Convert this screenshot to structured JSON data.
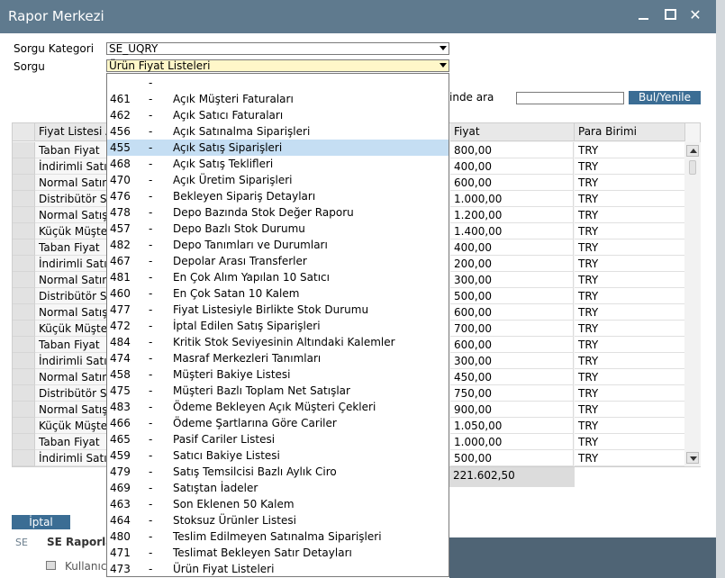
{
  "window": {
    "title": "Rapor Merkezi",
    "minimize_icon": "minimize-icon",
    "maximize_icon": "maximize-icon",
    "close_icon": "close-icon",
    "titlebar_color": "#5f7a8e"
  },
  "form": {
    "category_label": "Sorgu Kategori",
    "category_value": "SE_UQRY",
    "query_label": "Sorgu",
    "query_value": "Ürün Fiyat Listeleri",
    "search_label": "inde ara",
    "search_value": "",
    "find_button": "Bul/Yenile"
  },
  "grid": {
    "headers": {
      "price_list": "Fiyat Listesi A",
      "price": "Fiyat",
      "currency": "Para Birimi"
    },
    "rows": [
      {
        "name": "Taban Fiyat",
        "price": "800,00",
        "currency": "TRY"
      },
      {
        "name": "İndirimli Satın",
        "price": "400,00",
        "currency": "TRY"
      },
      {
        "name": "Normal Satın A",
        "price": "600,00",
        "currency": "TRY"
      },
      {
        "name": "Distribütör Sat",
        "price": "1.000,00",
        "currency": "TRY"
      },
      {
        "name": "Normal Satış F",
        "price": "1.200,00",
        "currency": "TRY"
      },
      {
        "name": "Küçük Müşteri",
        "price": "1.400,00",
        "currency": "TRY"
      },
      {
        "name": "Taban Fiyat",
        "price": "400,00",
        "currency": "TRY"
      },
      {
        "name": "İndirimli Satın",
        "price": "200,00",
        "currency": "TRY"
      },
      {
        "name": "Normal Satın A",
        "price": "300,00",
        "currency": "TRY"
      },
      {
        "name": "Distribütör Sat",
        "price": "500,00",
        "currency": "TRY"
      },
      {
        "name": "Normal Satış F",
        "price": "600,00",
        "currency": "TRY"
      },
      {
        "name": "Küçük Müşteri",
        "price": "700,00",
        "currency": "TRY"
      },
      {
        "name": "Taban Fiyat",
        "price": "600,00",
        "currency": "TRY"
      },
      {
        "name": "İndirimli Satın",
        "price": "300,00",
        "currency": "TRY"
      },
      {
        "name": "Normal Satın A",
        "price": "450,00",
        "currency": "TRY"
      },
      {
        "name": "Distribütör Sat",
        "price": "750,00",
        "currency": "TRY"
      },
      {
        "name": "Normal Satış F",
        "price": "900,00",
        "currency": "TRY"
      },
      {
        "name": "Küçük Müşteri",
        "price": "1.050,00",
        "currency": "TRY"
      },
      {
        "name": "Taban Fiyat",
        "price": "1.000,00",
        "currency": "TRY"
      },
      {
        "name": "İndirimli Satın",
        "price": "500,00",
        "currency": "TRY"
      }
    ],
    "total": "221.602,50"
  },
  "footer": {
    "cancel_button": "İptal",
    "bg_se": "SE",
    "bg_title": "SE Raporla",
    "bg_user": "Kullanıc"
  },
  "dropdown": {
    "selected_index": 4,
    "items": [
      {
        "code": "",
        "dash": "-",
        "text": ""
      },
      {
        "code": "461",
        "dash": "-",
        "text": "Açık Müşteri Faturaları"
      },
      {
        "code": "462",
        "dash": "-",
        "text": "Açık Satıcı Faturaları"
      },
      {
        "code": "456",
        "dash": "-",
        "text": "Açık Satınalma Siparişleri"
      },
      {
        "code": "455",
        "dash": "-",
        "text": "Açık Satış Siparişleri"
      },
      {
        "code": "468",
        "dash": "-",
        "text": "Açık Satış Teklifleri"
      },
      {
        "code": "470",
        "dash": "-",
        "text": "Açık Üretim Siparişleri"
      },
      {
        "code": "476",
        "dash": "-",
        "text": "Bekleyen Sipariş Detayları"
      },
      {
        "code": "478",
        "dash": "-",
        "text": "Depo Bazında Stok Değer Raporu"
      },
      {
        "code": "457",
        "dash": "-",
        "text": "Depo Bazlı Stok Durumu"
      },
      {
        "code": "482",
        "dash": "-",
        "text": "Depo Tanımları ve Durumları"
      },
      {
        "code": "467",
        "dash": "-",
        "text": "Depolar Arası Transferler"
      },
      {
        "code": "481",
        "dash": "-",
        "text": "En Çok Alım Yapılan 10 Satıcı"
      },
      {
        "code": "460",
        "dash": "-",
        "text": "En Çok Satan 10 Kalem"
      },
      {
        "code": "477",
        "dash": "-",
        "text": "Fiyat Listesiyle Birlikte Stok Durumu"
      },
      {
        "code": "472",
        "dash": "-",
        "text": "İptal Edilen Satış Siparişleri"
      },
      {
        "code": "484",
        "dash": "-",
        "text": "Kritik Stok Seviyesinin Altındaki Kalemler"
      },
      {
        "code": "474",
        "dash": "-",
        "text": "Masraf Merkezleri Tanımları"
      },
      {
        "code": "458",
        "dash": "-",
        "text": "Müşteri Bakiye Listesi"
      },
      {
        "code": "475",
        "dash": "-",
        "text": "Müşteri Bazlı Toplam Net Satışlar"
      },
      {
        "code": "483",
        "dash": "-",
        "text": "Ödeme Bekleyen Açık Müşteri Çekleri"
      },
      {
        "code": "466",
        "dash": "-",
        "text": "Ödeme Şartlarına Göre Cariler"
      },
      {
        "code": "465",
        "dash": "-",
        "text": "Pasif Cariler Listesi"
      },
      {
        "code": "459",
        "dash": "-",
        "text": "Satıcı Bakiye Listesi"
      },
      {
        "code": "479",
        "dash": "-",
        "text": "Satış Temsilcisi Bazlı Aylık Ciro"
      },
      {
        "code": "469",
        "dash": "-",
        "text": "Satıştan İadeler"
      },
      {
        "code": "463",
        "dash": "-",
        "text": "Son Eklenen 50 Kalem"
      },
      {
        "code": "464",
        "dash": "-",
        "text": "Stoksuz Ürünler Listesi"
      },
      {
        "code": "480",
        "dash": "-",
        "text": "Teslim Edilmeyen Satınalma Siparişleri"
      },
      {
        "code": "471",
        "dash": "-",
        "text": "Teslimat Bekleyen Satır Detayları"
      },
      {
        "code": "473",
        "dash": "-",
        "text": "Ürün Fiyat Listeleri"
      }
    ]
  }
}
